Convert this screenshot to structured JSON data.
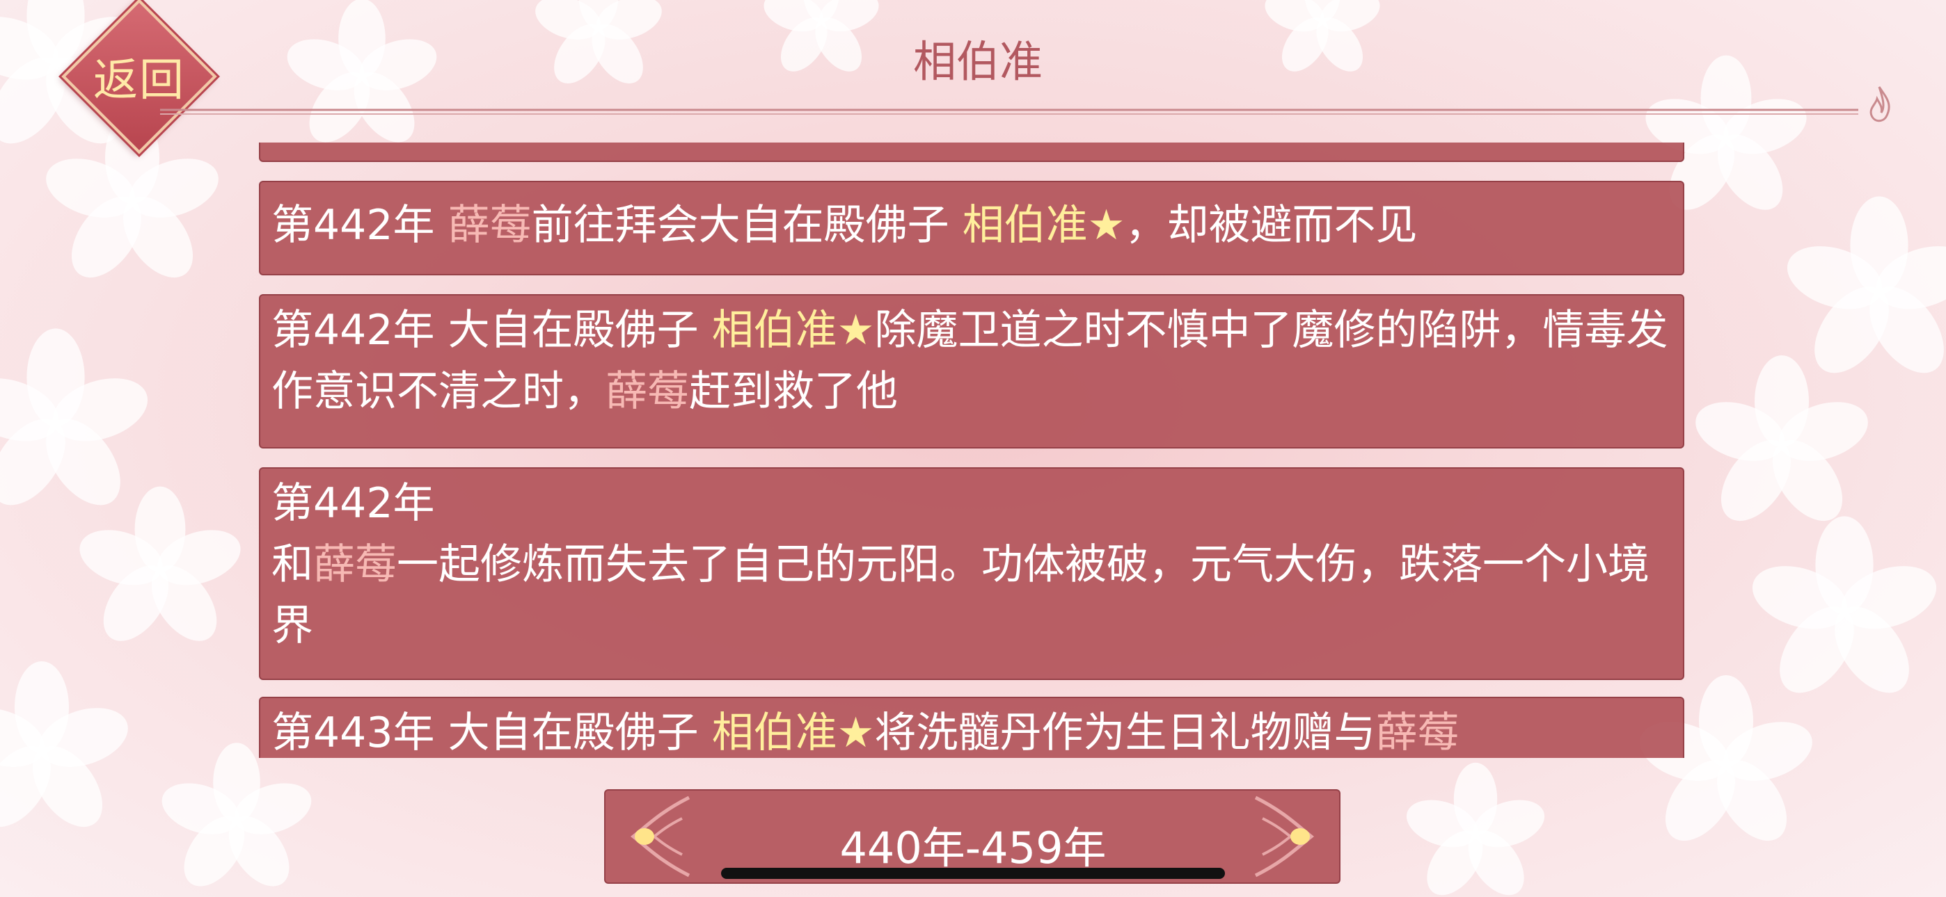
{
  "header": {
    "back_label": "返回",
    "title": "相伯准"
  },
  "entries": [
    {
      "year": "第442年",
      "parts": [
        "",
        "薛莓",
        "前往拜会大自在殿佛子 ",
        "相伯准★",
        "，却被避而不见"
      ]
    },
    {
      "year": "第442年",
      "parts": [
        "大自在殿佛子 ",
        "相伯准★",
        "除魔卫道之时不慎中了魔修的陷阱，情毒发作意识不清之时，",
        "薛莓",
        "赶到救了他"
      ]
    },
    {
      "year": "第442年",
      "parts": [
        "和",
        "薛莓",
        "一起修炼而失去了自己的元阳。功体被破，元气大伤，跌落一个小境界"
      ]
    },
    {
      "year": "第443年",
      "parts": [
        "大自在殿佛子 ",
        "相伯准★",
        "将洗髓丹作为生日礼物赠与",
        "薛莓"
      ]
    }
  ],
  "pager": {
    "range_label": "440年-459年"
  },
  "colors": {
    "panel": "#b2545a",
    "name_highlight": "#ffef9c",
    "mc_highlight": "#f7b9b4",
    "title": "#b2585f"
  }
}
